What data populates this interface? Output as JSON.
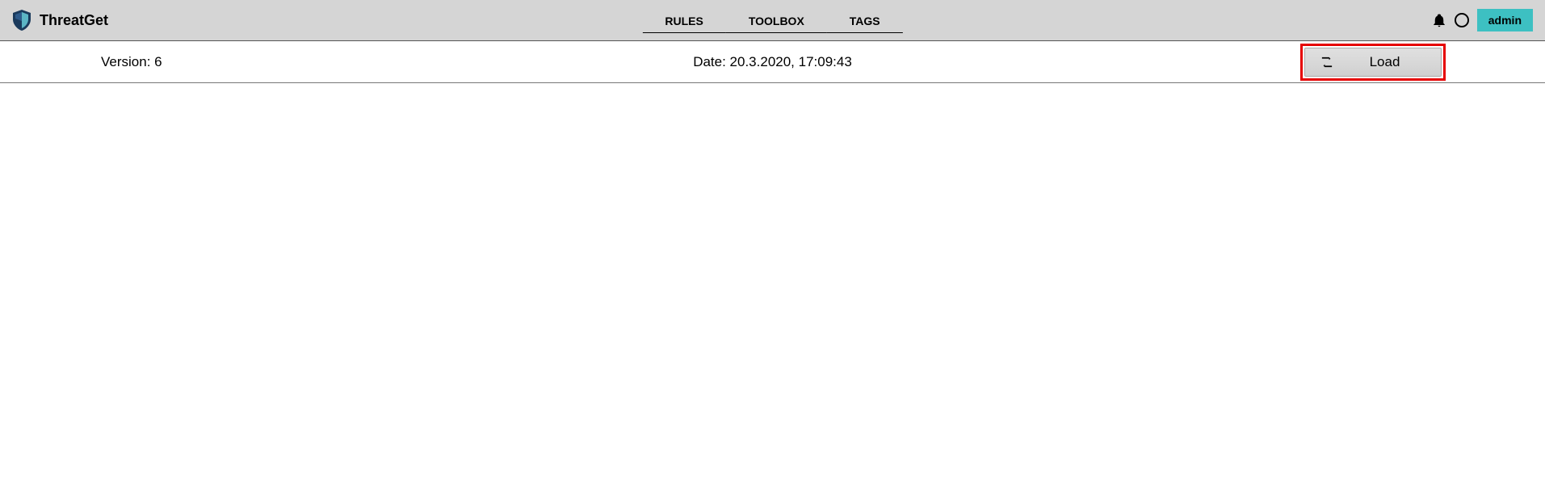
{
  "header": {
    "app_title": "ThreatGet",
    "nav": {
      "rules": "RULES",
      "toolbox": "TOOLBOX",
      "tags": "TAGS"
    },
    "user": "admin"
  },
  "info_bar": {
    "version": "Version: 6",
    "date": "Date: 20.3.2020, 17:09:43",
    "load_button": "Load"
  }
}
